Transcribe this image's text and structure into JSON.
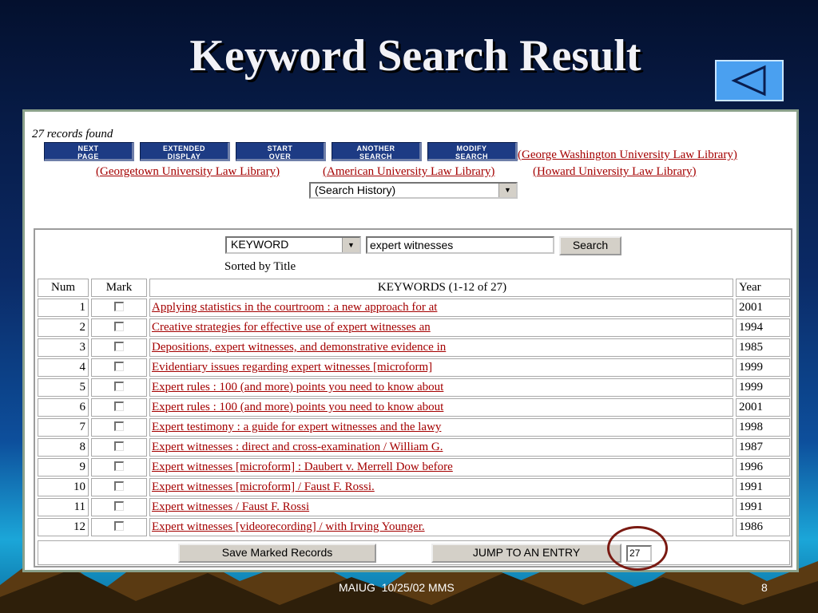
{
  "slide": {
    "title": "Keyword Search Result",
    "footer": "MAIUG  10/25/02 MMS",
    "page_number": "8"
  },
  "results": {
    "records_found": "27 records found",
    "nav_buttons": [
      {
        "line1": "Next",
        "line2": "Page"
      },
      {
        "line1": "Extended",
        "line2": "Display"
      },
      {
        "line1": "Start",
        "line2": "Over"
      },
      {
        "line1": "Another",
        "line2": "Search"
      },
      {
        "line1": "Modify",
        "line2": "Search"
      }
    ],
    "library_links": [
      "(George Washington University Law Library)",
      "(Georgetown University Law Library)",
      "(American University Law Library)",
      "(Howard University Law Library)"
    ],
    "history_select": "(Search History)",
    "search": {
      "type": "KEYWORD",
      "query": "expert witnesses",
      "button": "Search",
      "sorted_by": "Sorted by Title"
    },
    "table": {
      "headers": {
        "num": "Num",
        "mark": "Mark",
        "title": "KEYWORDS (1-12 of 27)",
        "year": "Year"
      },
      "rows": [
        {
          "num": "1",
          "title": "Applying statistics in the courtroom : a new approach for at",
          "year": "2001"
        },
        {
          "num": "2",
          "title": "Creative strategies for effective use of expert witnesses an",
          "year": "1994"
        },
        {
          "num": "3",
          "title": "Depositions, expert witnesses, and demonstrative evidence in",
          "year": "1985"
        },
        {
          "num": "4",
          "title": "Evidentiary issues regarding expert witnesses [microform]",
          "year": "1999"
        },
        {
          "num": "5",
          "title": "Expert rules : 100 (and more) points you need to know about",
          "year": "1999"
        },
        {
          "num": "6",
          "title": "Expert rules : 100 (and more) points you need to know about",
          "year": "2001"
        },
        {
          "num": "7",
          "title": "Expert testimony : a guide for expert witnesses and the lawy",
          "year": "1998"
        },
        {
          "num": "8",
          "title": "Expert witnesses : direct and cross-examination / William G.",
          "year": "1987"
        },
        {
          "num": "9",
          "title": "Expert witnesses [microform] : Daubert v. Merrell Dow before",
          "year": "1996"
        },
        {
          "num": "10",
          "title": "Expert witnesses [microform] / Faust F. Rossi.",
          "year": "1991"
        },
        {
          "num": "11",
          "title": "Expert witnesses / Faust F. Rossi",
          "year": "1991"
        },
        {
          "num": "12",
          "title": "Expert witnesses [videorecording] / with Irving Younger.",
          "year": "1986"
        }
      ]
    },
    "save_button": "Save Marked Records",
    "jump_button": "JUMP TO AN ENTRY",
    "jump_value": "27"
  },
  "colors": {
    "link": "#a40000",
    "nav_button": "#1d3b84",
    "annotation_circle": "#7a1a12",
    "back_button": "#4aa0f0"
  },
  "icons": {
    "back": "left-triangle-icon",
    "dropdown": "chevron-down-icon"
  }
}
